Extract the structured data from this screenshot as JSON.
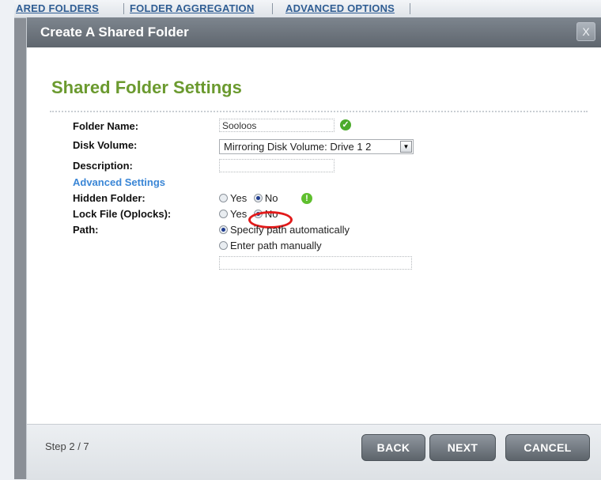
{
  "background": {
    "tabs": [
      "ARED FOLDERS",
      "FOLDER AGGREGATION",
      "ADVANCED OPTIONS"
    ]
  },
  "dialog": {
    "title": "Create A Shared Folder",
    "close_label": "X",
    "section_title": "Shared Folder Settings",
    "fields": {
      "folder_name": {
        "label": "Folder Name:",
        "value": "Sooloos"
      },
      "disk_volume": {
        "label": "Disk Volume:",
        "value": "Mirroring Disk Volume: Drive 1 2"
      },
      "description": {
        "label": "Description:",
        "value": ""
      },
      "advanced_settings": {
        "label": "Advanced Settings"
      },
      "hidden_folder": {
        "label": "Hidden Folder:",
        "yes": "Yes",
        "no": "No",
        "selected": "No"
      },
      "lock_file": {
        "label": "Lock File (Oplocks):",
        "yes": "Yes",
        "no": "No",
        "selected": "No"
      },
      "path": {
        "label": "Path:",
        "option_auto": "Specify path automatically",
        "option_manual": "Enter path manually",
        "selected": "Specify path automatically",
        "manual_value": ""
      }
    },
    "footer": {
      "step": "Step 2 / 7",
      "back": "BACK",
      "next": "NEXT",
      "cancel": "CANCEL"
    }
  },
  "colors": {
    "section_title": "#6b9a2f",
    "advanced_link": "#3a86d6",
    "highlight_circle": "#e21b1b",
    "titlebar": "#6a7179"
  }
}
